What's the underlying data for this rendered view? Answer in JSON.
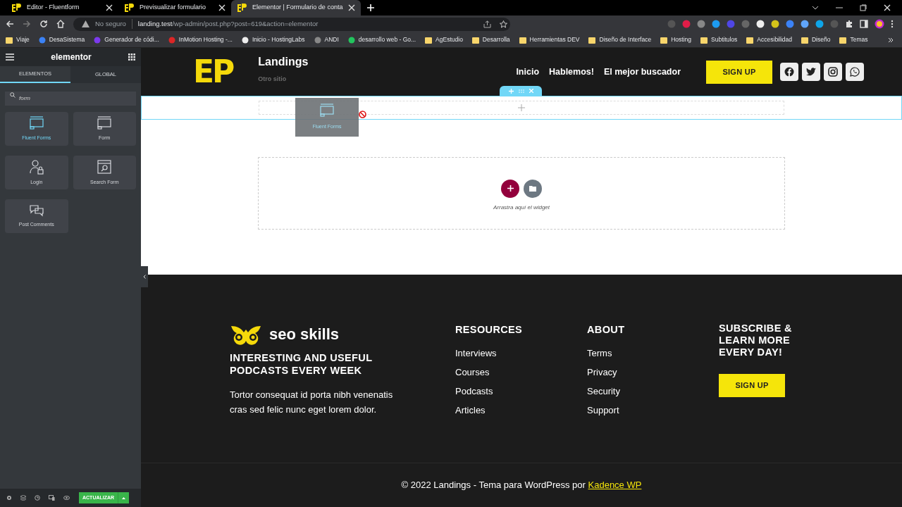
{
  "browser": {
    "tabs": [
      {
        "title": "Editor - Fluentform",
        "selected": false
      },
      {
        "title": "Previsualizar formulario",
        "selected": false
      },
      {
        "title": "Elementor | Formulario de conta",
        "selected": true
      }
    ],
    "address": {
      "security": "No seguro",
      "host": "landing.test",
      "path": "/wp-admin/post.php?post=619&action=elementor"
    },
    "bookmarks": [
      {
        "label": "Viaje",
        "kind": "folder"
      },
      {
        "label": "DesaSistema",
        "kind": "site"
      },
      {
        "label": "Generador de códi...",
        "kind": "site"
      },
      {
        "label": "InMotion Hosting -...",
        "kind": "site"
      },
      {
        "label": "Inicio - HostingLabs",
        "kind": "site"
      },
      {
        "label": "ANDI",
        "kind": "site"
      },
      {
        "label": "desarrollo web - Go...",
        "kind": "site"
      },
      {
        "label": "AgEstudio",
        "kind": "folder"
      },
      {
        "label": "Desarrolla",
        "kind": "folder"
      },
      {
        "label": "Herramientas DEV",
        "kind": "folder"
      },
      {
        "label": "Diseño de Interface",
        "kind": "folder"
      },
      {
        "label": "Hosting",
        "kind": "folder"
      },
      {
        "label": "Subtitulos",
        "kind": "folder"
      },
      {
        "label": "Accesibilidad",
        "kind": "folder"
      },
      {
        "label": "Diseño",
        "kind": "folder"
      },
      {
        "label": "Temas",
        "kind": "folder"
      }
    ]
  },
  "sidebar": {
    "title": "elementor",
    "tabs": [
      {
        "label": "ELEMENTOS",
        "selected": true
      },
      {
        "label": "GLOBAL",
        "selected": false
      }
    ],
    "search": {
      "value": "form"
    },
    "widgets": [
      {
        "label": "Fluent Forms",
        "kind": "form",
        "active": true
      },
      {
        "label": "Form",
        "kind": "form",
        "active": false
      },
      {
        "label": "Login",
        "kind": "login",
        "active": false
      },
      {
        "label": "Search Form",
        "kind": "search",
        "active": false
      },
      {
        "label": "Post Comments",
        "kind": "comments",
        "active": false
      }
    ],
    "update_button": "ACTUALIZAR"
  },
  "site": {
    "header": {
      "logo": "EP",
      "title": "Landings",
      "tagline": "Otro sitio",
      "nav": [
        "Inicio",
        "Hablemos!",
        "El mejor buscador"
      ],
      "signup": "SIGN UP"
    },
    "drag_ghost": "Fluent Forms",
    "empty_section": "Arrastra aquí el widget",
    "footer": {
      "brand": "seo skills",
      "headline": "INTERESTING AND USEFUL PODCASTS EVERY WEEK",
      "text": "Tortor consequat id porta nibh venenatis cras sed felic nunc eget lorem dolor.",
      "columns": [
        {
          "heading": "RESOURCES",
          "links": [
            "Interviews",
            "Courses",
            "Podcasts",
            "Articles"
          ]
        },
        {
          "heading": "ABOUT",
          "links": [
            "Terms",
            "Privacy",
            "Security",
            "Support"
          ]
        }
      ],
      "subscribe": "SUBSCRIBE & LEARN MORE EVERY DAY!",
      "signup": "SIGN UP",
      "copyright": "© 2022 Landings - Tema para WordPress por ",
      "copyright_link": "Kadence WP"
    }
  }
}
